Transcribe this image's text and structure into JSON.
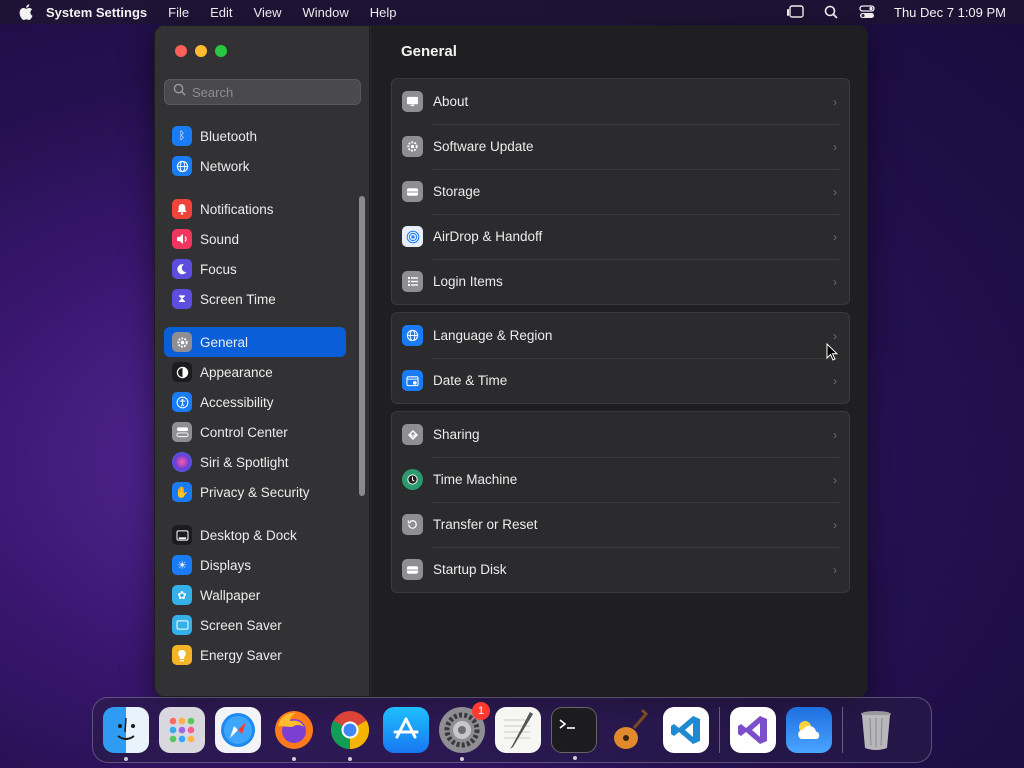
{
  "menubar": {
    "app": "System Settings",
    "items": [
      "File",
      "Edit",
      "View",
      "Window",
      "Help"
    ],
    "datetime": "Thu Dec 7  1:09 PM"
  },
  "sidebar": {
    "search_placeholder": "Search",
    "items": [
      {
        "label": "Bluetooth",
        "color": "#1a7cf5"
      },
      {
        "label": "Network",
        "color": "#1a7cf5"
      },
      {
        "label": "Notifications",
        "color": "#f0443a"
      },
      {
        "label": "Sound",
        "color": "#f0365c"
      },
      {
        "label": "Focus",
        "color": "#5e4ee0"
      },
      {
        "label": "Screen Time",
        "color": "#5e4ee0"
      },
      {
        "label": "General",
        "color": "#8e8e93"
      },
      {
        "label": "Appearance",
        "color": "#1c1c1e"
      },
      {
        "label": "Accessibility",
        "color": "#1a7cf5"
      },
      {
        "label": "Control Center",
        "color": "#8e8e93"
      },
      {
        "label": "Siri & Spotlight",
        "color": "#a03ad0"
      },
      {
        "label": "Privacy & Security",
        "color": "#1a7cf5"
      },
      {
        "label": "Desktop & Dock",
        "color": "#1c1c1e"
      },
      {
        "label": "Displays",
        "color": "#1a7cf5"
      },
      {
        "label": "Wallpaper",
        "color": "#35b0e8"
      },
      {
        "label": "Screen Saver",
        "color": "#35b0e8"
      },
      {
        "label": "Energy Saver",
        "color": "#f5b428"
      }
    ]
  },
  "main": {
    "title": "General",
    "group1": [
      "About",
      "Software Update",
      "Storage",
      "AirDrop & Handoff",
      "Login Items"
    ],
    "group2": [
      "Language & Region",
      "Date & Time"
    ],
    "group3": [
      "Sharing",
      "Time Machine",
      "Transfer or Reset",
      "Startup Disk"
    ]
  },
  "dock": {
    "apps": [
      "Finder",
      "Launchpad",
      "Safari",
      "Firefox",
      "Chrome",
      "App Store",
      "System Settings",
      "TextEdit",
      "Terminal",
      "GarageBand",
      "Visual Studio Code",
      "Visual Studio",
      "Weather",
      "Trash"
    ],
    "badge": "1"
  }
}
